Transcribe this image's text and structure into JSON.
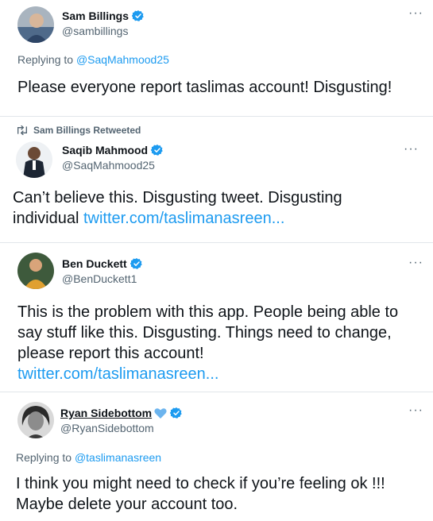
{
  "tweets": [
    {
      "name": "Sam Billings",
      "handle": "@sambillings",
      "more": "···",
      "replying_prefix": "Replying to ",
      "replying_to": "@SaqMahmood25",
      "text": "Please everyone report taslimas account! Disgusting!"
    },
    {
      "retweet_label": "Sam Billings Retweeted",
      "name": "Saqib Mahmood",
      "handle": "@SaqMahmood25",
      "more": "···",
      "text_line1": "Can’t believe this. Disgusting tweet. Disgusting",
      "text_line2": "individual ",
      "link": "twitter.com/taslimanasreen..."
    },
    {
      "name": "Ben Duckett",
      "handle": "@BenDuckett1",
      "more": "···",
      "text_line1": "This is the problem with this app. People being able to",
      "text_line2": "say stuff like this. Disgusting. Things need to change,",
      "text_line3": "please report this account!",
      "link": "twitter.com/taslimanasreen..."
    },
    {
      "name": "Ryan Sidebottom",
      "handle": "@RyanSidebottom",
      "more": "···",
      "replying_prefix": "Replying to ",
      "replying_to": "@taslimanasreen",
      "text_line1": "I think you might need to check if you’re feeling ok !!!",
      "text_line2": "Maybe delete your account too."
    }
  ],
  "colors": {
    "verified": "#1d9bf0",
    "link": "#1d9bf0",
    "muted": "#536471",
    "heart": "#6cb4ee"
  },
  "icons": [
    "verified-badge-icon",
    "more-options-icon",
    "retweet-icon",
    "blue-heart-icon"
  ]
}
